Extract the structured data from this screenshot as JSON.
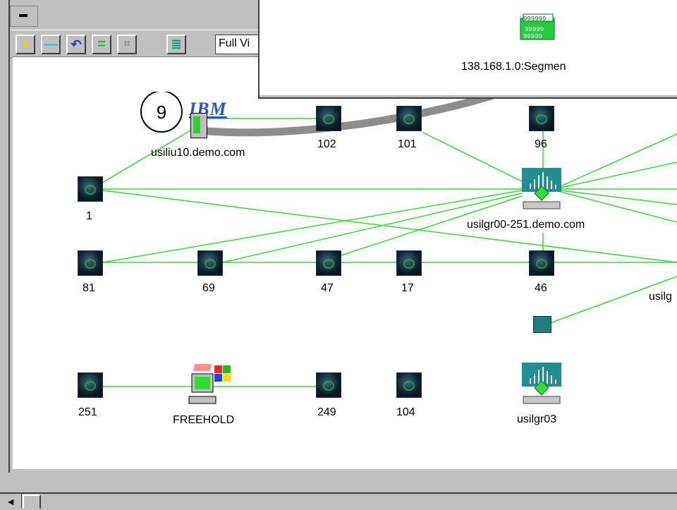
{
  "window": {
    "view_select": "Full Vi",
    "toolbar": {
      "add_label": "+",
      "remove_label": "—",
      "undo_label": "↶",
      "equal_label": "=",
      "grid_label": "⌗",
      "list_label": "≣"
    },
    "scroll_left_label": "◄"
  },
  "popup": {
    "segment_label": "138.168.1.0:Segmen"
  },
  "callout_number": "9",
  "ibm_logo_text": "IBM",
  "nodes": {
    "usiliu10": "usiliu10.demo.com",
    "n102": "102",
    "n101": "101",
    "n96": "96",
    "n1": "1",
    "router1": "usilgr00-251.demo.com",
    "n81": "81",
    "n69": "69",
    "n47": "47",
    "n17": "17",
    "n46": "46",
    "usilg_cut": "usilg",
    "n251": "251",
    "freehold": "FREEHOLD",
    "n249": "249",
    "n104": "104",
    "router3": "usilgr03"
  },
  "colors": {
    "link": "#33dd33",
    "tube": "#8c8c8c",
    "chrome": "#c0c0c0"
  }
}
